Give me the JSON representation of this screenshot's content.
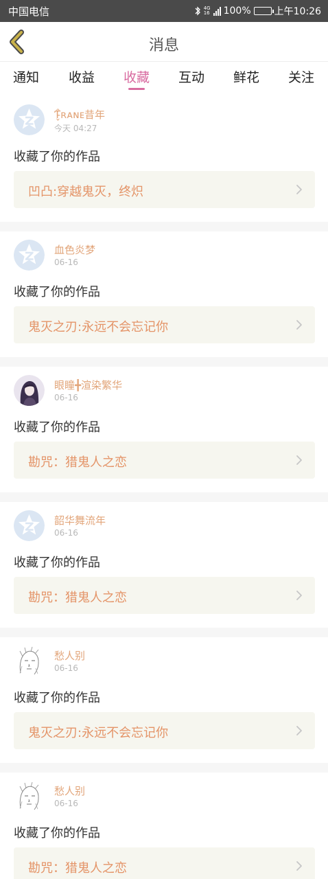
{
  "status_bar": {
    "carrier": "中国电信",
    "network": "4G",
    "network_sub": "16",
    "battery": "100%",
    "time": "上午10:26",
    "icons": [
      "bluetooth-icon",
      "signal-icon",
      "battery-icon"
    ]
  },
  "header": {
    "title": "消息",
    "back_icon": "chevron-left-icon",
    "accent_color": "#d86ba0",
    "back_color": "#c9b24a"
  },
  "tabs": [
    {
      "label": "通知"
    },
    {
      "label": "收益"
    },
    {
      "label": "收藏",
      "active": true
    },
    {
      "label": "互动"
    },
    {
      "label": "鲜花"
    },
    {
      "label": "关注"
    }
  ],
  "items": [
    {
      "user": "Ƭ̵̬̊ʀᴀɴᴇ昔年",
      "date": "今天 04:27",
      "action": "收藏了你的作品",
      "work": "凹凸:穿越鬼灭，终炽",
      "avatar": "default-avatar-icon"
    },
    {
      "user": "血色炎梦",
      "date": "06-16",
      "action": "收藏了你的作品",
      "work": "鬼灭之刃:永远不会忘记你",
      "avatar": "default-avatar-icon"
    },
    {
      "user": "眼瞳╋渲染繁华",
      "date": "06-16",
      "action": "收藏了你的作品",
      "work": "勘咒：猎鬼人之恋",
      "avatar": "photo-avatar"
    },
    {
      "user": "韶华舞流年",
      "date": "06-16",
      "action": "收藏了你的作品",
      "work": "勘咒：猎鬼人之恋",
      "avatar": "default-avatar-icon"
    },
    {
      "user": "愁人别",
      "date": "06-16",
      "action": "收藏了你的作品",
      "work": "鬼灭之刃:永远不会忘记你",
      "avatar": "sketch-avatar"
    },
    {
      "user": "愁人别",
      "date": "06-16",
      "action": "收藏了你的作品",
      "work": "勘咒：猎鬼人之恋",
      "avatar": "sketch-avatar"
    }
  ]
}
